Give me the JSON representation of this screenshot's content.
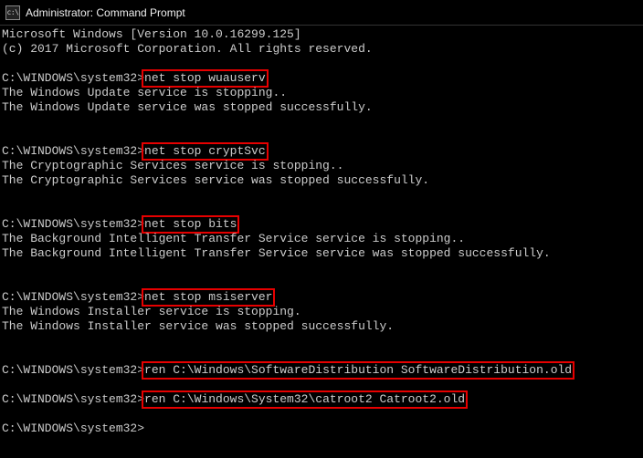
{
  "titlebar": {
    "icon_label": "cmd",
    "title": "Administrator: Command Prompt"
  },
  "prompt": "C:\\WINDOWS\\system32>",
  "header": {
    "line1": "Microsoft Windows [Version 10.0.16299.125]",
    "line2": "(c) 2017 Microsoft Corporation. All rights reserved."
  },
  "blocks": [
    {
      "cmd": "net stop wuauserv",
      "out1": "The Windows Update service is stopping..",
      "out2": "The Windows Update service was stopped successfully."
    },
    {
      "cmd": "net stop cryptSvc",
      "out1": "The Cryptographic Services service is stopping..",
      "out2": "The Cryptographic Services service was stopped successfully."
    },
    {
      "cmd": "net stop bits",
      "out1": "The Background Intelligent Transfer Service service is stopping..",
      "out2": "The Background Intelligent Transfer Service service was stopped successfully."
    },
    {
      "cmd": "net stop msiserver",
      "out1": "The Windows Installer service is stopping.",
      "out2": "The Windows Installer service was stopped successfully."
    }
  ],
  "rename_cmds": [
    "ren C:\\Windows\\SoftwareDistribution SoftwareDistribution.old",
    "ren C:\\Windows\\System32\\catroot2 Catroot2.old"
  ]
}
